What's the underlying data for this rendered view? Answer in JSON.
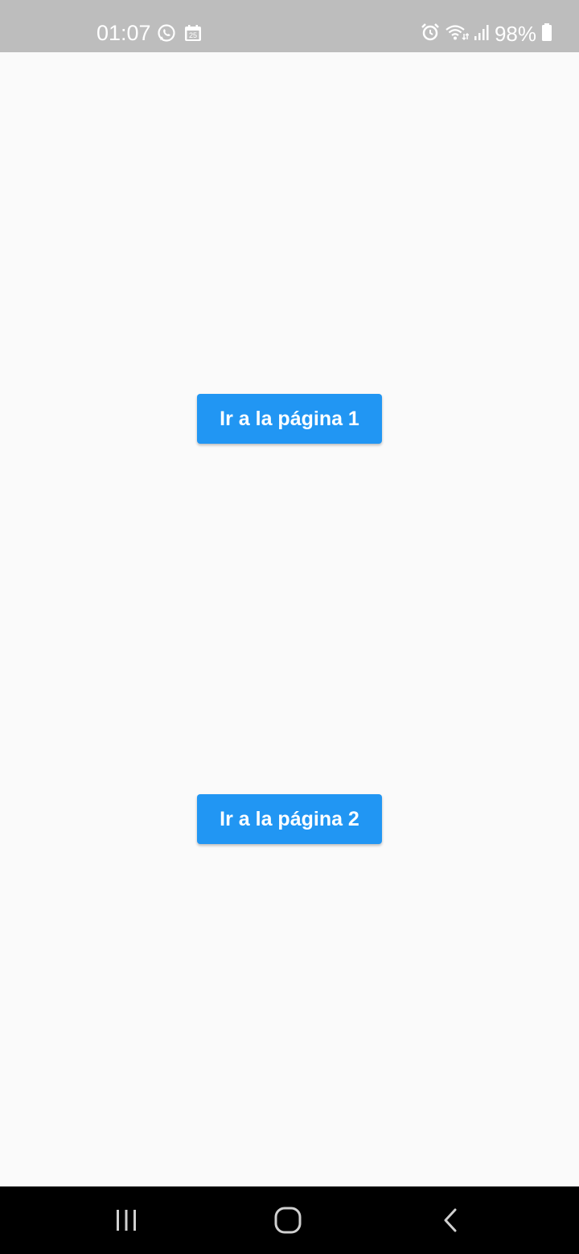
{
  "status_bar": {
    "time": "01:07",
    "battery": "98%",
    "left_icons": [
      "whatsapp-icon",
      "calendar-icon"
    ],
    "right_icons": [
      "alarm-icon",
      "wifi-icon",
      "signal-icon",
      "battery-icon"
    ]
  },
  "main": {
    "button_page1_label": "Ir a la página 1",
    "button_page2_label": "Ir a la página 2",
    "accent_color": "#2196f3"
  },
  "nav_bar": {
    "icons": [
      "recent-apps-icon",
      "home-icon",
      "back-icon"
    ]
  }
}
